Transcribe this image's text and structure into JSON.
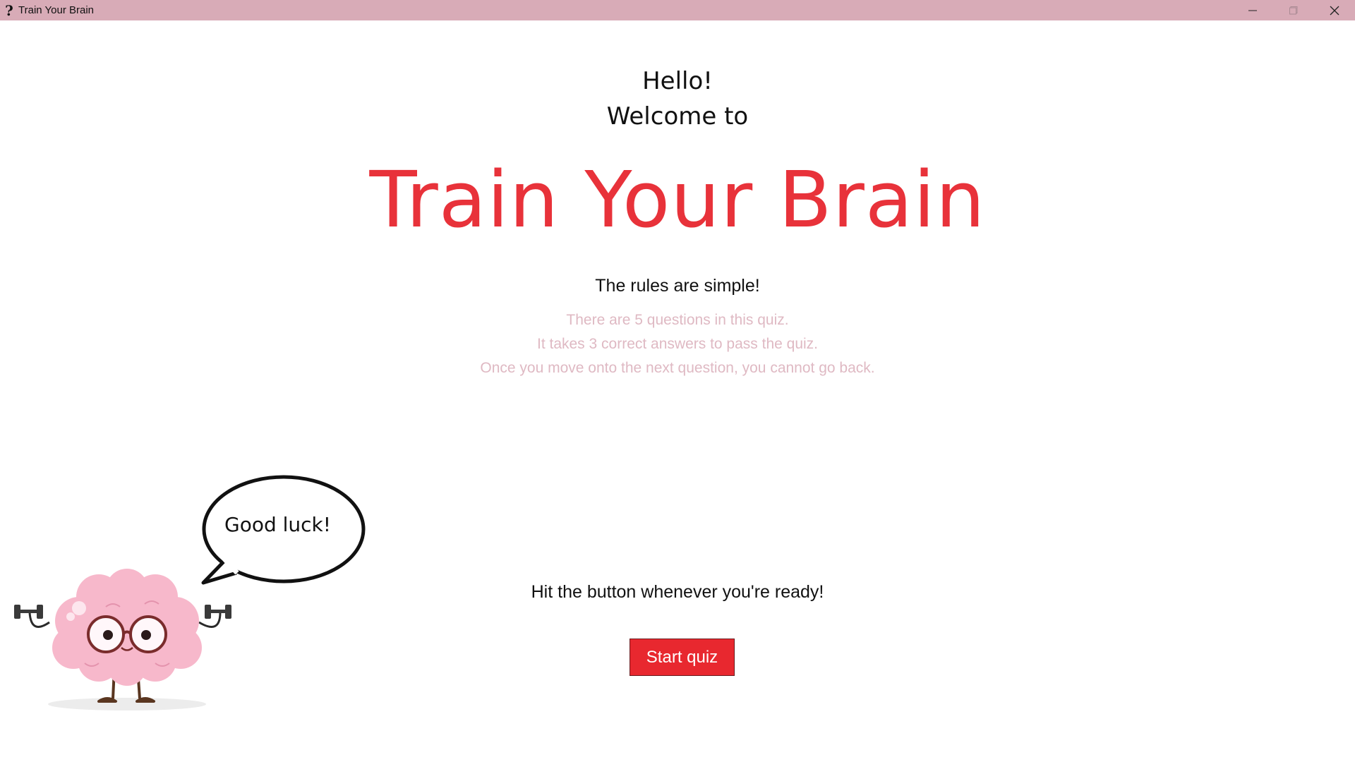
{
  "window": {
    "title": "Train Your Brain",
    "icon": "question-mark-icon",
    "controls": [
      "minimize-icon",
      "maximize-icon",
      "close-icon"
    ],
    "titlebar_color": "#d8abb7"
  },
  "intro": {
    "hello": "Hello!",
    "welcome": "Welcome to",
    "brand": "Train Your Brain",
    "brand_color": "#e8323a"
  },
  "rules": {
    "title": "The rules are simple!",
    "items": [
      "There are 5 questions in this quiz.",
      "It takes 3 correct answers to pass the quiz.",
      "Once you move onto the next question, you cannot go back."
    ],
    "item_color": "#dfb9c3"
  },
  "mascot": {
    "speech": "Good luck!",
    "image": "brain-lifting-dumbbells-illustration"
  },
  "footer": {
    "ready_text": "Hit the button whenever you're ready!",
    "start_label": "Start quiz",
    "button_color": "#e8282f"
  }
}
